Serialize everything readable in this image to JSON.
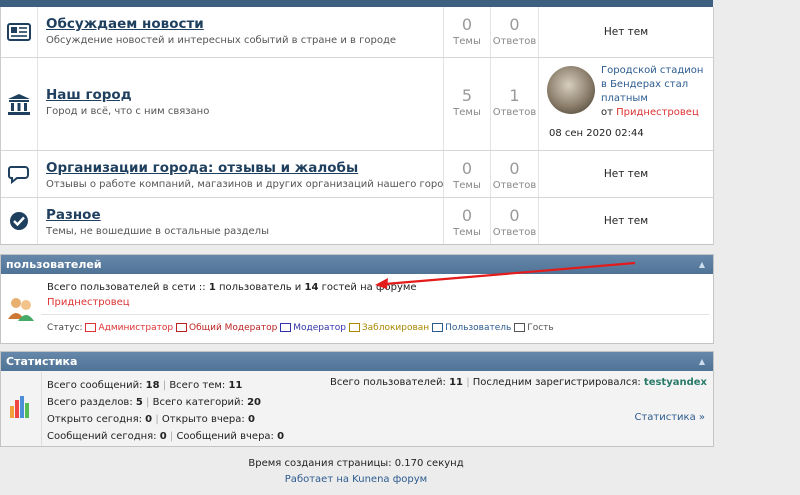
{
  "forums": [
    {
      "icon": "newspaper-icon",
      "title": "Обсуждаем новости",
      "desc": "Обсуждение новостей и интересных событий в стране и в городе",
      "topics": "0",
      "replies": "0",
      "topics_label": "Темы",
      "replies_label": "Ответов",
      "last": "Нет тем"
    },
    {
      "icon": "bank-icon",
      "title": "Наш город",
      "desc": "Город и всё, что с ним связано",
      "topics": "5",
      "replies": "1",
      "topics_label": "Темы",
      "replies_label": "Ответов",
      "last_post": {
        "title": "Городской стадион в Бендерах стал платным",
        "from": "от",
        "author": "Приднестровец",
        "date": "08 сен 2020 02:44"
      }
    },
    {
      "icon": "chat-icon",
      "title": "Организации города: отзывы и жалобы",
      "desc": "Отзывы о работе компаний, магазинов и других организаций нашего города.",
      "topics": "0",
      "replies": "0",
      "topics_label": "Темы",
      "replies_label": "Ответов",
      "last": "Нет тем"
    },
    {
      "icon": "check-circle-icon",
      "title": "Разное",
      "desc": "Темы, не вошедшие в остальные разделы",
      "topics": "0",
      "replies": "0",
      "topics_label": "Темы",
      "replies_label": "Ответов",
      "last": "Нет тем"
    }
  ],
  "users": {
    "header": "пользователей",
    "online_prefix": "Всего пользователей в сети :: ",
    "online_users": "1",
    "online_mid": " пользователь и ",
    "online_guests": "14",
    "online_suffix": " гостей на форуме",
    "online_name": "Приднестровец",
    "status_label": "Статус:",
    "legend": [
      {
        "label": "Администратор",
        "color": "#d33"
      },
      {
        "label": "Общий Модератор",
        "color": "#b22"
      },
      {
        "label": "Модератор",
        "color": "#33a"
      },
      {
        "label": "Заблокирован",
        "color": "#a80"
      },
      {
        "label": "Пользователь",
        "color": "#2c5b8f"
      },
      {
        "label": "Гость",
        "color": "#555"
      }
    ]
  },
  "stats": {
    "header": "Статистика",
    "total_posts_label": "Всего сообщений:",
    "total_posts": "18",
    "total_topics_label": "Всего тем:",
    "total_topics": "11",
    "sections_label": "Всего разделов:",
    "sections": "5",
    "categories_label": "Всего категорий:",
    "categories": "20",
    "open_today_label": "Открыто сегодня:",
    "open_today": "0",
    "open_yesterday_label": "Открыто вчера:",
    "open_yesterday": "0",
    "posts_today_label": "Сообщений сегодня:",
    "posts_today": "0",
    "posts_yesterday_label": "Сообщений вчера:",
    "posts_yesterday": "0",
    "total_users_label": "Всего пользователей:",
    "total_users": "11",
    "last_reg_label": "Последним зарегистрировался:",
    "last_reg": "testyandex",
    "more_link": "Статистика »"
  },
  "footer": {
    "time": "Время создания страницы: 0.170 секунд",
    "powered": "Работает на Kunena форум"
  }
}
